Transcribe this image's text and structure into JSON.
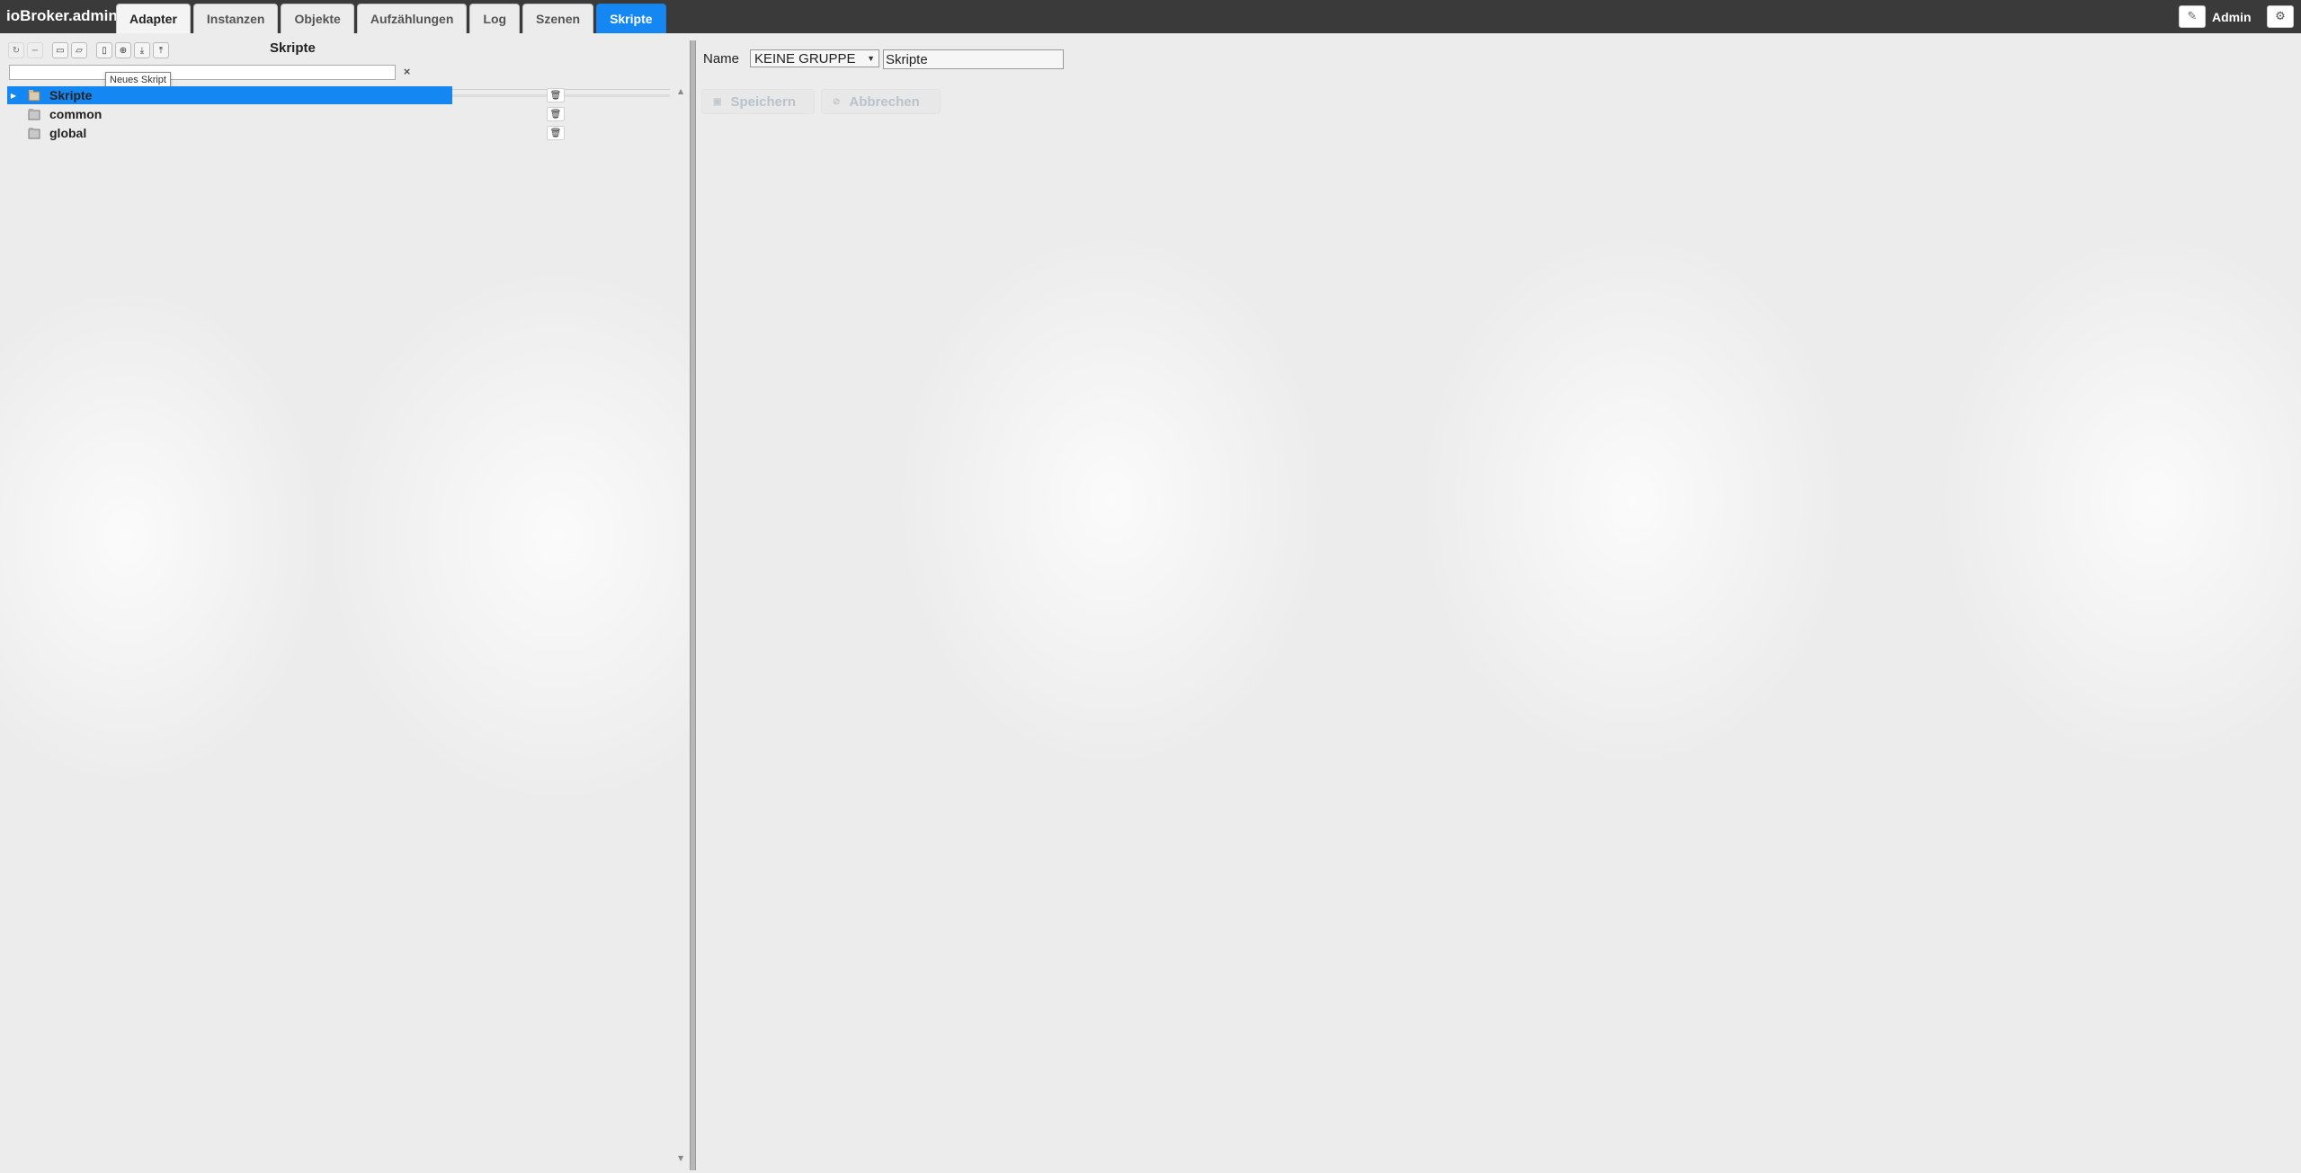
{
  "app": {
    "title": "ioBroker.admin"
  },
  "tabs": [
    {
      "label": "Adapter"
    },
    {
      "label": "Instanzen"
    },
    {
      "label": "Objekte"
    },
    {
      "label": "Aufzählungen"
    },
    {
      "label": "Log"
    },
    {
      "label": "Szenen"
    },
    {
      "label": "Skripte",
      "active": true
    }
  ],
  "user": {
    "name": "Admin",
    "edit_icon": "pencil-icon",
    "settings_icon": "gear-icon"
  },
  "left_panel": {
    "title": "Skripte",
    "toolbar_icons": [
      "refresh-icon",
      "collapse-icon",
      "folder-icon",
      "folder-open-icon",
      "new-script-icon",
      "add-folder-icon",
      "import-icon",
      "export-icon"
    ],
    "tooltip": "Neues Skript",
    "filter_value": "",
    "filter_clear": "×",
    "tree": [
      {
        "label": "Skripte",
        "selected": true,
        "expandable": true
      },
      {
        "label": "common",
        "selected": false
      },
      {
        "label": "global",
        "selected": false
      }
    ]
  },
  "right_panel": {
    "name_label": "Name",
    "group_select": "KEINE GRUPPE",
    "script_name": "Skripte",
    "save_label": "Speichern",
    "cancel_label": "Abbrechen"
  },
  "colors": {
    "accent": "#1587f2",
    "topbar": "#3a3a3a",
    "background": "#ececec"
  }
}
